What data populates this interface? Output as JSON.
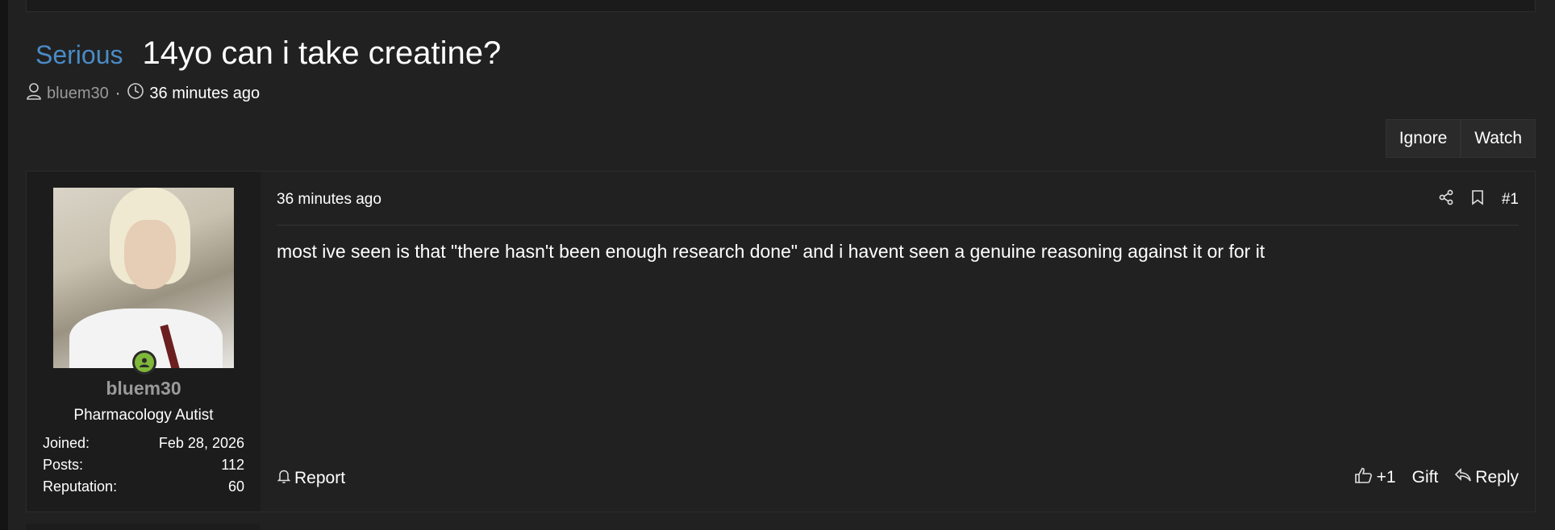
{
  "thread": {
    "prefix": "Serious",
    "title": "14yo can i take creatine?",
    "author": "bluem30",
    "separator": "·",
    "time": "36 minutes ago"
  },
  "thread_actions": {
    "ignore_label": "Ignore",
    "watch_label": "Watch"
  },
  "post": {
    "time": "36 minutes ago",
    "number": "#1",
    "body": "most ive seen is that \"there hasn't been enough research done\" and i havent seen a genuine reasoning against it or for it",
    "report_label": "Report",
    "like_count": "+1",
    "gift_label": "Gift",
    "reply_label": "Reply"
  },
  "user": {
    "name": "bluem30",
    "title": "Pharmacology Autist",
    "stats": [
      {
        "label": "Joined:",
        "value": "Feb 28, 2026"
      },
      {
        "label": "Posts:",
        "value": "112"
      },
      {
        "label": "Reputation:",
        "value": "60"
      }
    ]
  },
  "colors": {
    "background": "#212121",
    "prefix": "#4a8bc6",
    "username": "#9a9a9a",
    "online": "#7fb83a"
  },
  "icons": {
    "author": "user-icon",
    "time": "clock-icon",
    "share": "share-icon",
    "bookmark": "bookmark-icon",
    "report": "bell-icon",
    "like": "thumbs-up-icon",
    "reply": "reply-icon"
  }
}
